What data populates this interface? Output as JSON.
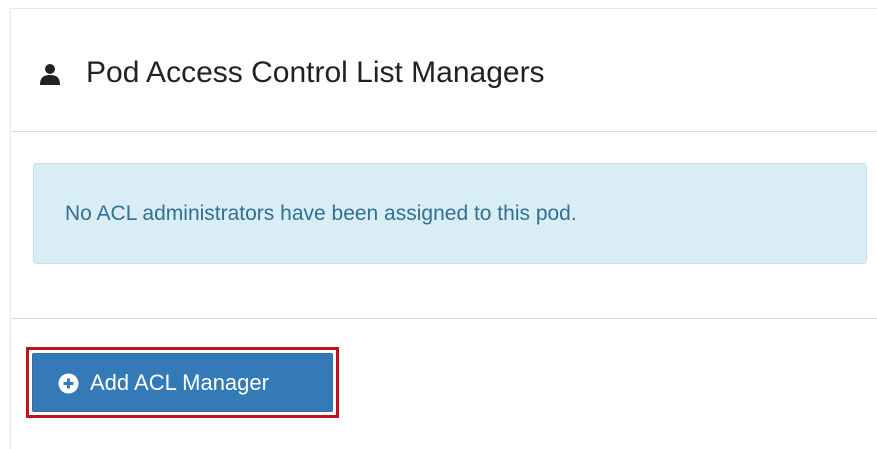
{
  "panel": {
    "title": "Pod Access Control List Managers",
    "title_icon": "user-icon",
    "alert_message": "No ACL administrators have been assigned to this pod.",
    "add_button": {
      "label": "Add ACL Manager",
      "icon": "plus-circle-icon"
    }
  },
  "colors": {
    "primary_button": "#337ab7",
    "alert_background": "#d9edf7",
    "alert_text": "#31708f",
    "highlight_border": "#c1121f"
  }
}
